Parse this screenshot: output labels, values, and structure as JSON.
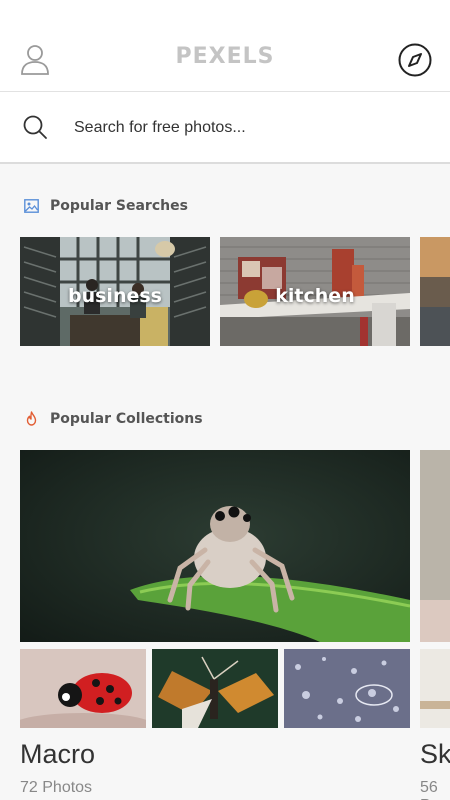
{
  "header": {
    "brand": "PEXELS",
    "profile_icon": "user-icon",
    "explore_icon": "compass-icon"
  },
  "search": {
    "placeholder": "Search for free photos...",
    "icon": "search-icon"
  },
  "popular_searches": {
    "title": "Popular Searches",
    "icon": "image-icon",
    "items": [
      {
        "label": "business"
      },
      {
        "label": "kitchen"
      },
      {
        "label": ""
      }
    ]
  },
  "popular_collections": {
    "title": "Popular Collections",
    "icon": "flame-icon",
    "items": [
      {
        "name": "Macro",
        "count": "72 Photos"
      },
      {
        "name": "Sk",
        "count": "56 P"
      }
    ]
  },
  "colors": {
    "accent_red": "#e25d33",
    "accent_blue": "#5b8fd8",
    "brand_gray": "#c4c4c4"
  }
}
